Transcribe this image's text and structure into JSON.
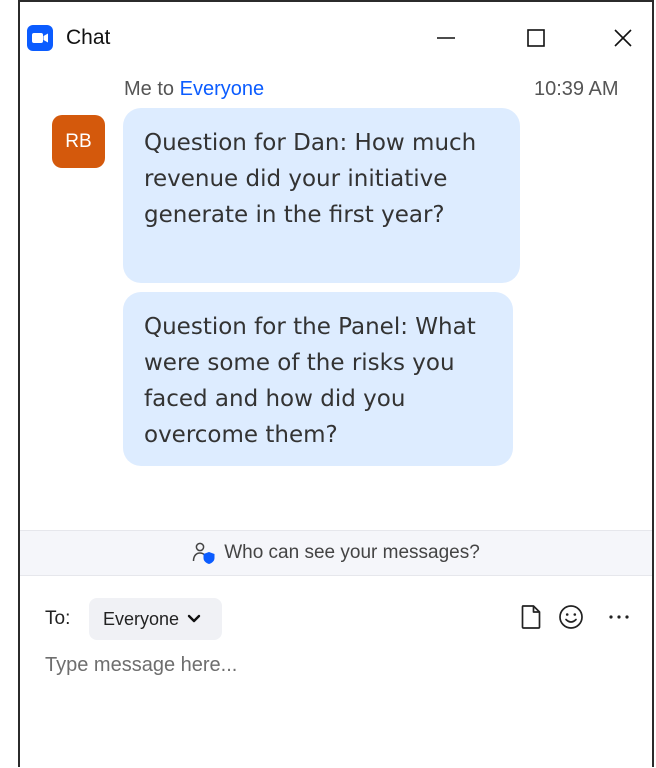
{
  "window": {
    "title": "Chat",
    "controls": [
      "minimize",
      "maximize",
      "close"
    ]
  },
  "conversation": {
    "sender": "Me",
    "connector": "to",
    "recipient": "Everyone",
    "timestamp": "10:39 AM",
    "avatar_initials": "RB",
    "avatar_color": "#d4590c",
    "messages": [
      "Question for Dan:  How much revenue did your initiative generate in the first year?",
      "Question for the Panel:  What were some of the risks you faced and how did you overcome them?"
    ]
  },
  "privacy": {
    "label": "Who can see your messages?",
    "icon": "people-shield-icon"
  },
  "composer": {
    "to_label": "To:",
    "recipient": "Everyone",
    "placeholder": "Type message here...",
    "tools": [
      "file-icon",
      "emoji-icon",
      "more-icon"
    ]
  },
  "colors": {
    "accent": "#0b5cff",
    "bubble": "#ddecff",
    "privacy_bar": "#f5f6fa"
  }
}
